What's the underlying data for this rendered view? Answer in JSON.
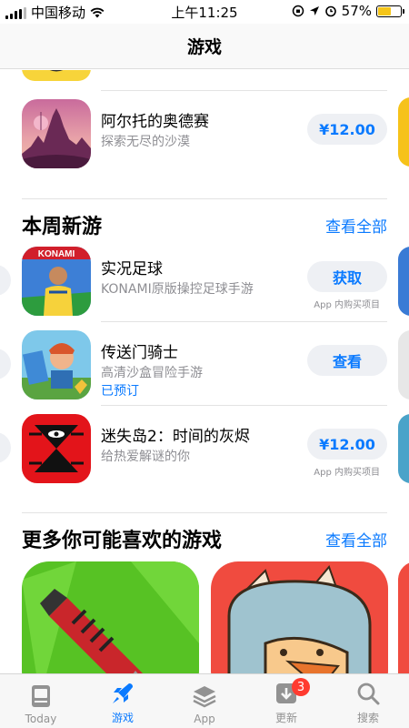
{
  "status": {
    "carrier": "中国移动",
    "time": "上午11:25",
    "battery": "57%",
    "battery_level": 0.57
  },
  "nav": {
    "title": "游戏"
  },
  "top_app": {
    "name": "阿尔托的奥德赛",
    "subtitle": "探索无尽的沙漠",
    "price": "¥12.00"
  },
  "new_games": {
    "title": "本周新游",
    "see_all": "查看全部",
    "apps": [
      {
        "name": "实况足球",
        "subtitle": "KONAMI原版操控足球手游",
        "button": "获取",
        "note": "App 内购买项目",
        "icon_text": "KONAMI"
      },
      {
        "name": "传送门骑士",
        "subtitle": "高清沙盒冒险手游",
        "tag": "已预订",
        "button": "查看"
      },
      {
        "name": "迷失岛2：时间的灰烬",
        "subtitle": "给热爱解谜的你",
        "button": "¥12.00",
        "note": "App 内购买项目"
      }
    ]
  },
  "more_games": {
    "title": "更多你可能喜欢的游戏",
    "see_all": "查看全部"
  },
  "tabs": [
    {
      "label": "Today",
      "icon": "today-icon"
    },
    {
      "label": "游戏",
      "icon": "rocket-icon",
      "active": true
    },
    {
      "label": "App",
      "icon": "layers-icon"
    },
    {
      "label": "更新",
      "icon": "download-icon",
      "badge": "3"
    },
    {
      "label": "搜索",
      "icon": "search-icon"
    }
  ],
  "colors": {
    "accent": "#0a7aff",
    "badge": "#ff3b30",
    "battery": "#f5c518"
  }
}
